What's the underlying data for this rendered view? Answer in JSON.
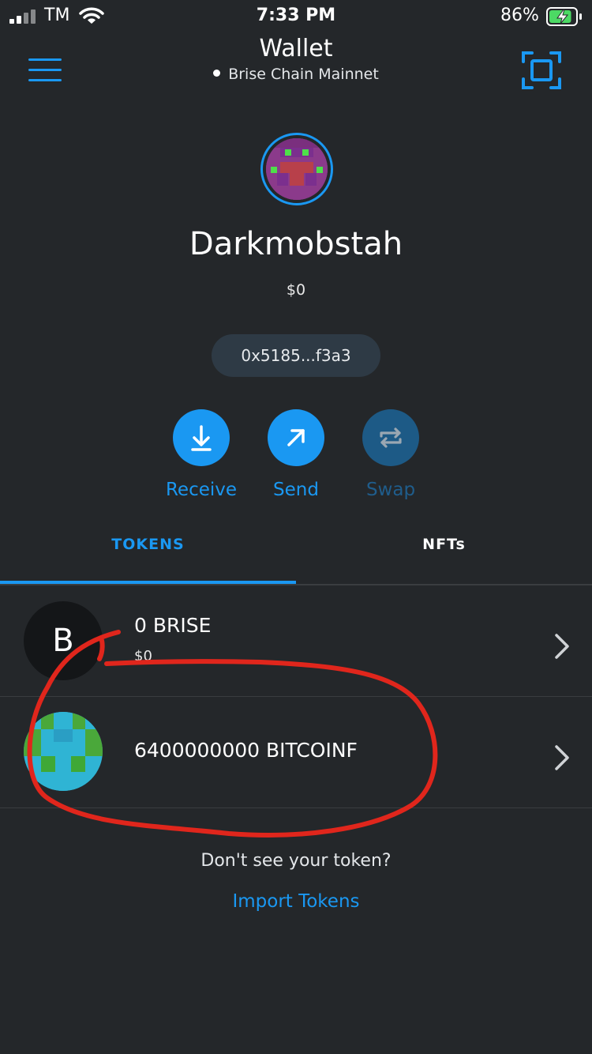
{
  "status_bar": {
    "carrier": "TM",
    "time": "7:33 PM",
    "battery_percent": "86%",
    "battery_level": 0.86,
    "charging": true
  },
  "header": {
    "title": "Wallet",
    "network": "Brise Chain Mainnet",
    "menu_icon": "hamburger-menu-icon",
    "scan_icon": "qr-scan-icon"
  },
  "account": {
    "name": "Darkmobstah",
    "balance": "$0",
    "address": "0x5185...f3a3"
  },
  "actions": {
    "receive": "Receive",
    "send": "Send",
    "swap": "Swap"
  },
  "tabs": {
    "tokens": "TOKENS",
    "nfts": "NFTs",
    "active": "tokens"
  },
  "tokens": [
    {
      "icon_letter": "B",
      "amount": "0 BRISE",
      "fiat": "$0"
    },
    {
      "amount": "6400000000 BITCOINF",
      "fiat": ""
    }
  ],
  "footer": {
    "hint": "Don't see your token?",
    "import_link": "Import Tokens"
  },
  "colors": {
    "background": "#24272a",
    "accent": "#1a98f2",
    "annotation": "#e0261c"
  }
}
